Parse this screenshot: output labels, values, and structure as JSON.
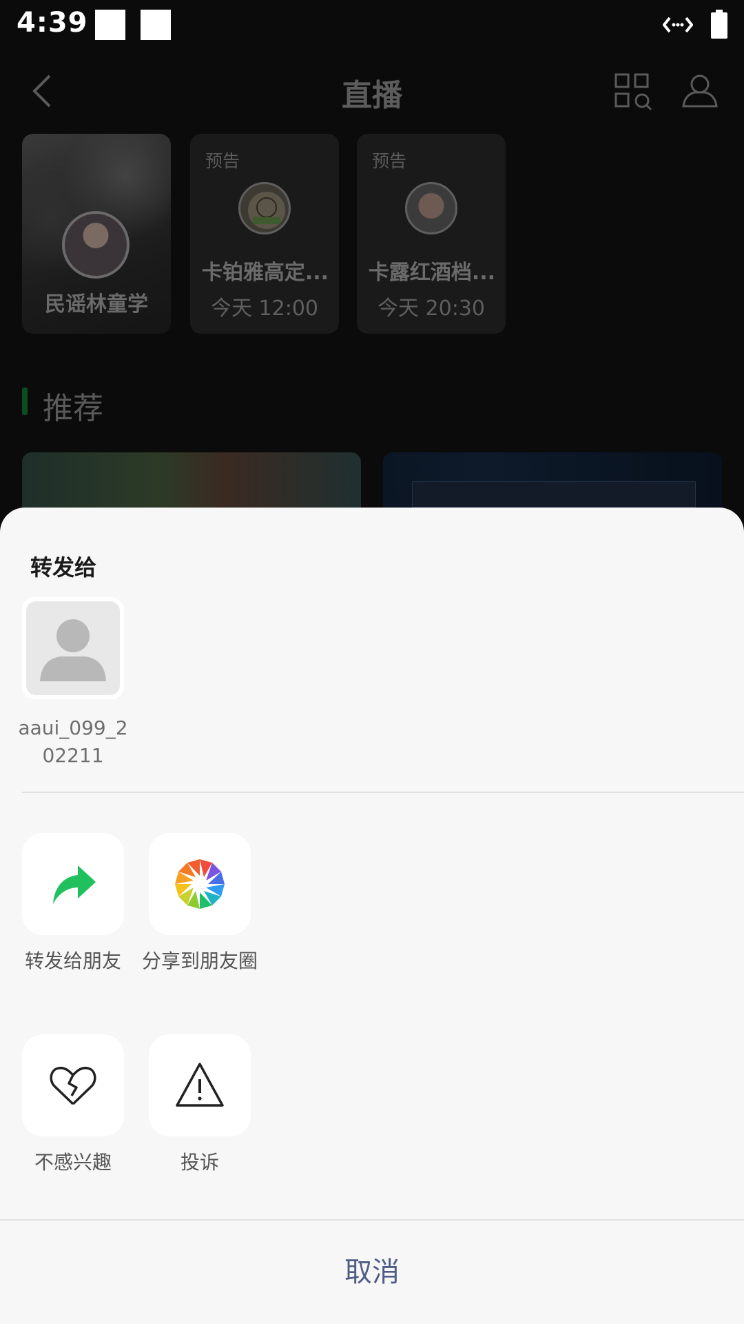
{
  "status_bar": {
    "time": "4:39"
  },
  "header": {
    "title": "直播"
  },
  "live_cards": [
    {
      "name": "民谣林童学"
    },
    {
      "tag": "预告",
      "title": "卡铂雅高定...",
      "time": "今天 12:00"
    },
    {
      "tag": "预告",
      "title": "卡露红酒档...",
      "time": "今天 20:30"
    }
  ],
  "recommend": {
    "title": "推荐"
  },
  "share_sheet": {
    "title": "转发给",
    "contact": {
      "name": "aaui_099_202211"
    },
    "actions": [
      {
        "label": "转发给朋友",
        "icon": "forward-arrow-icon"
      },
      {
        "label": "分享到朋友圈",
        "icon": "moments-aperture-icon"
      },
      {
        "label": "不感兴趣",
        "icon": "broken-heart-icon"
      },
      {
        "label": "投诉",
        "icon": "warning-triangle-icon"
      }
    ],
    "cancel": "取消"
  },
  "colors": {
    "accent_green": "#20c05c",
    "cancel_text": "#4e5d85",
    "sheet_bg": "#f7f7f7",
    "overlay_bg": "#0b0b0b"
  }
}
